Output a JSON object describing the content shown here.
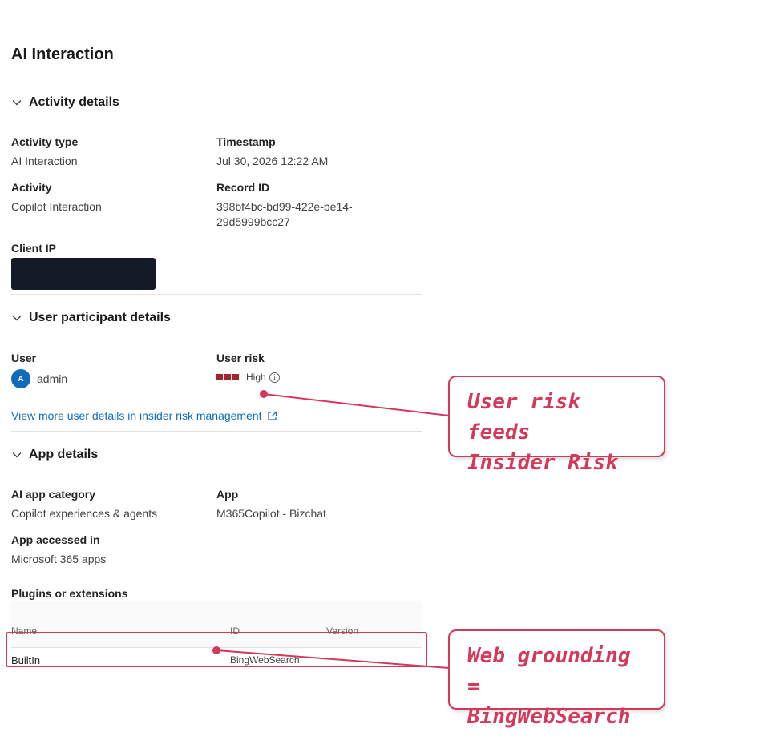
{
  "page": {
    "title": "AI Interaction"
  },
  "sections": {
    "activity": {
      "heading": "Activity details",
      "activity_type_label": "Activity type",
      "activity_type_value": "AI Interaction",
      "timestamp_label": "Timestamp",
      "timestamp_value": "Jul 30, 2026 12:22 AM",
      "activity_label": "Activity",
      "activity_value": "Copilot Interaction",
      "record_id_label": "Record ID",
      "record_id_line1": "398bf4bc-bd99-422e-be14-",
      "record_id_line2": "29d5999bcc27",
      "client_ip_label": "Client IP"
    },
    "user": {
      "heading": "User participant details",
      "user_label": "User",
      "avatar_initial": "A",
      "user_value": "admin",
      "risk_label": "User risk",
      "risk_value": "High",
      "risk_level_bars": 3,
      "risk_color": "#a4262c",
      "link_text": "View more user details in insider risk management"
    },
    "app": {
      "heading": "App details",
      "category_label": "AI app category",
      "category_value": "Copilot experiences & agents",
      "app_label": "App",
      "app_value": "M365Copilot - Bizchat",
      "accessed_label": "App accessed in",
      "accessed_value": "Microsoft 365 apps",
      "plugins_label": "Plugins or extensions",
      "table": {
        "headers": [
          "Name",
          "ID",
          "Version"
        ],
        "rows": [
          {
            "name": "BuiltIn",
            "id": "BingWebSearch",
            "version": ""
          }
        ]
      }
    }
  },
  "annotations": {
    "callout_1_line1": "User risk feeds",
    "callout_1_line2": "Insider Risk",
    "callout_2_line1": "Web grounding =",
    "callout_2_line2": "BingWebSearch",
    "color": "#d2395b"
  },
  "icons": {
    "chevron": "chevron-down-icon",
    "info": "info-icon",
    "external": "external-link-icon"
  }
}
